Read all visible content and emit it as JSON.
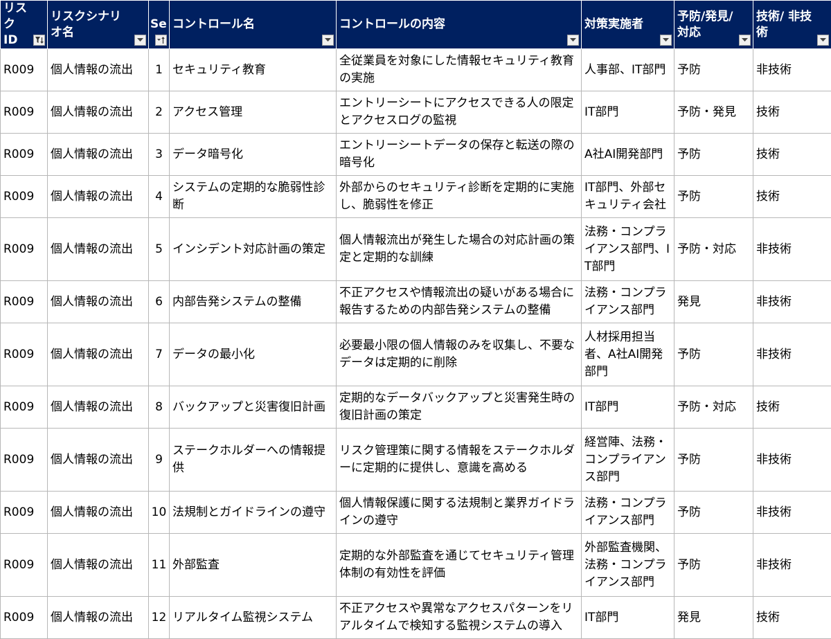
{
  "columns": [
    {
      "label": "リスク ID",
      "filter_icon": "filter-active-icon"
    },
    {
      "label": "リスクシナリオ名",
      "filter_icon": "dropdown-icon"
    },
    {
      "label": "Se",
      "filter_icon": "sort-ascending-icon"
    },
    {
      "label": "コントロール名",
      "filter_icon": "dropdown-icon"
    },
    {
      "label": "コントロールの内容",
      "filter_icon": "dropdown-icon"
    },
    {
      "label": "対策実施者",
      "filter_icon": "dropdown-icon"
    },
    {
      "label": "予防/発見/ 対応",
      "filter_icon": "dropdown-icon"
    },
    {
      "label": "技術/ 非技術",
      "filter_icon": "dropdown-icon"
    }
  ],
  "rows": [
    [
      "R009",
      "個人情報の流出",
      "1",
      "セキュリティ教育",
      "全従業員を対象にした情報セキュリティ教育の実施",
      "人事部、IT部門",
      "予防",
      "非技術"
    ],
    [
      "R009",
      "個人情報の流出",
      "2",
      "アクセス管理",
      "エントリーシートにアクセスできる人の限定とアクセスログの監視",
      "IT部門",
      "予防・発見",
      "技術"
    ],
    [
      "R009",
      "個人情報の流出",
      "3",
      "データ暗号化",
      "エントリーシートデータの保存と転送の際の暗号化",
      "A社AI開発部門",
      "予防",
      "技術"
    ],
    [
      "R009",
      "個人情報の流出",
      "4",
      "システムの定期的な脆弱性診断",
      "外部からのセキュリティ診断を定期的に実施し、脆弱性を修正",
      "IT部門、外部セキュリティ会社",
      "予防",
      "技術"
    ],
    [
      "R009",
      "個人情報の流出",
      "5",
      "インシデント対応計画の策定",
      "個人情報流出が発生した場合の対応計画の策定と定期的な訓練",
      "法務・コンプライアンス部門、IT部門",
      "予防・対応",
      "非技術"
    ],
    [
      "R009",
      "個人情報の流出",
      "6",
      "内部告発システムの整備",
      "不正アクセスや情報流出の疑いがある場合に報告するための内部告発システムの整備",
      "法務・コンプライアンス部門",
      "発見",
      "非技術"
    ],
    [
      "R009",
      "個人情報の流出",
      "7",
      "データの最小化",
      "必要最小限の個人情報のみを収集し、不要なデータは定期的に削除",
      "人材採用担当者、A社AI開発部門",
      "予防",
      "非技術"
    ],
    [
      "R009",
      "個人情報の流出",
      "8",
      "バックアップと災害復旧計画",
      "定期的なデータバックアップと災害発生時の復旧計画の策定",
      "IT部門",
      "予防・対応",
      "技術"
    ],
    [
      "R009",
      "個人情報の流出",
      "9",
      "ステークホルダーへの情報提供",
      "リスク管理策に関する情報をステークホルダーに定期的に提供し、意識を高める",
      "経営陣、法務・コンプライアンス部門",
      "予防",
      "非技術"
    ],
    [
      "R009",
      "個人情報の流出",
      "10",
      "法規制とガイドラインの遵守",
      "個人情報保護に関する法規制と業界ガイドラインの遵守",
      "法務・コンプライアンス部門",
      "予防",
      "非技術"
    ],
    [
      "R009",
      "個人情報の流出",
      "11",
      "外部監査",
      "定期的な外部監査を通じてセキュリティ管理体制の有効性を評価",
      "外部監査機関、法務・コンプライアンス部門",
      "予防",
      "非技術"
    ],
    [
      "R009",
      "個人情報の流出",
      "12",
      "リアルタイム監視システム",
      "不正アクセスや異常なアクセスパターンをリアルタイムで検知する監視システムの導入",
      "IT部門",
      "発見",
      "技術"
    ]
  ],
  "colors": {
    "header_bg": "#002060",
    "header_text": "#ffffff",
    "grid": "#b7b7b7"
  }
}
